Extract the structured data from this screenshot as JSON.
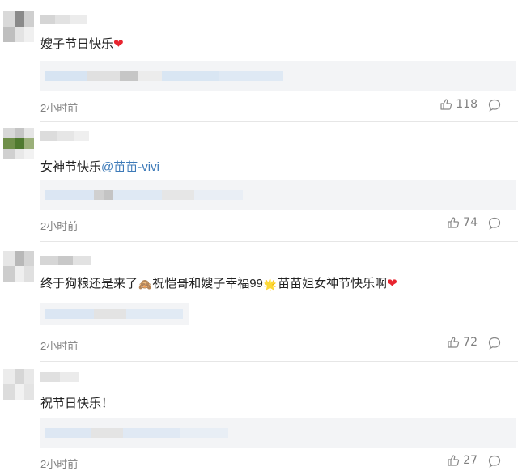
{
  "comments": [
    {
      "text": "嫂子节日快乐",
      "heart": "❤",
      "time": "2小时前",
      "likes": "118"
    },
    {
      "text": "女神节快乐",
      "mention": "@苗苗-vivi",
      "time": "2小时前",
      "likes": "74"
    },
    {
      "text_a": "终于狗粮还是来了",
      "emoji_a": "🙈",
      "text_b": "祝恺哥和嫂子幸福99",
      "emoji_b": "🌟",
      "text_c": "苗苗姐女神节快乐啊",
      "heart": "❤",
      "time": "2小时前",
      "likes": "72"
    },
    {
      "text": "祝节日快乐！",
      "time": "2小时前",
      "likes": "27"
    }
  ],
  "icons": {
    "like": "thumbs-up-icon",
    "reply": "comment-bubble-icon"
  },
  "colors": {
    "text": "#222222",
    "meta": "#808080",
    "mention": "#3d7ab8",
    "heart": "#e8242f",
    "reply_box": "#f3f4f6"
  }
}
